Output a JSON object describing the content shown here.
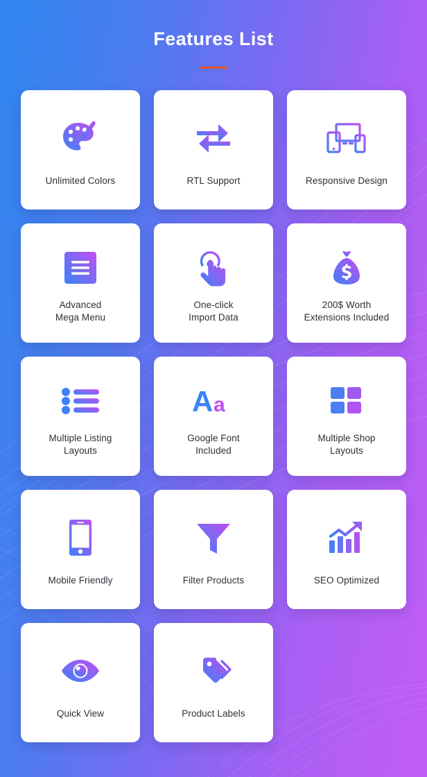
{
  "header": {
    "title": "Features List",
    "accent_color": "#e8541e"
  },
  "theme": {
    "background_gradient_start": "#2f86ef",
    "background_gradient_end": "#c25cf6",
    "card_background": "#ffffff",
    "label_color": "#2e2e38",
    "icon_gradient_start": "#3b82f6",
    "icon_gradient_end": "#c14ef0"
  },
  "features": [
    {
      "label": "Unlimited Colors",
      "icon": "palette-icon",
      "single_line": true
    },
    {
      "label": "RTL Support",
      "icon": "exchange-arrows-icon",
      "single_line": true
    },
    {
      "label": "Responsive Design",
      "icon": "devices-icon",
      "single_line": true
    },
    {
      "label": "Advanced\nMega Menu",
      "icon": "hamburger-menu-icon",
      "single_line": false
    },
    {
      "label": "One-click\nImport Data",
      "icon": "tap-hand-icon",
      "single_line": false
    },
    {
      "label": "200$ Worth\nExtensions Included",
      "icon": "money-bag-icon",
      "single_line": false
    },
    {
      "label": "Multiple Listing\nLayouts",
      "icon": "bullet-list-icon",
      "single_line": false
    },
    {
      "label": "Google Font\nIncluded",
      "icon": "typography-aa-icon",
      "single_line": false
    },
    {
      "label": "Multiple Shop\nLayouts",
      "icon": "grid-squares-icon",
      "single_line": false
    },
    {
      "label": "Mobile Friendly",
      "icon": "smartphone-icon",
      "single_line": true
    },
    {
      "label": "Filter Products",
      "icon": "funnel-icon",
      "single_line": true
    },
    {
      "label": "SEO Optimized",
      "icon": "growth-chart-icon",
      "single_line": true
    },
    {
      "label": "Quick View",
      "icon": "eye-icon",
      "single_line": true
    },
    {
      "label": "Product Labels",
      "icon": "price-tags-icon",
      "single_line": true
    }
  ]
}
